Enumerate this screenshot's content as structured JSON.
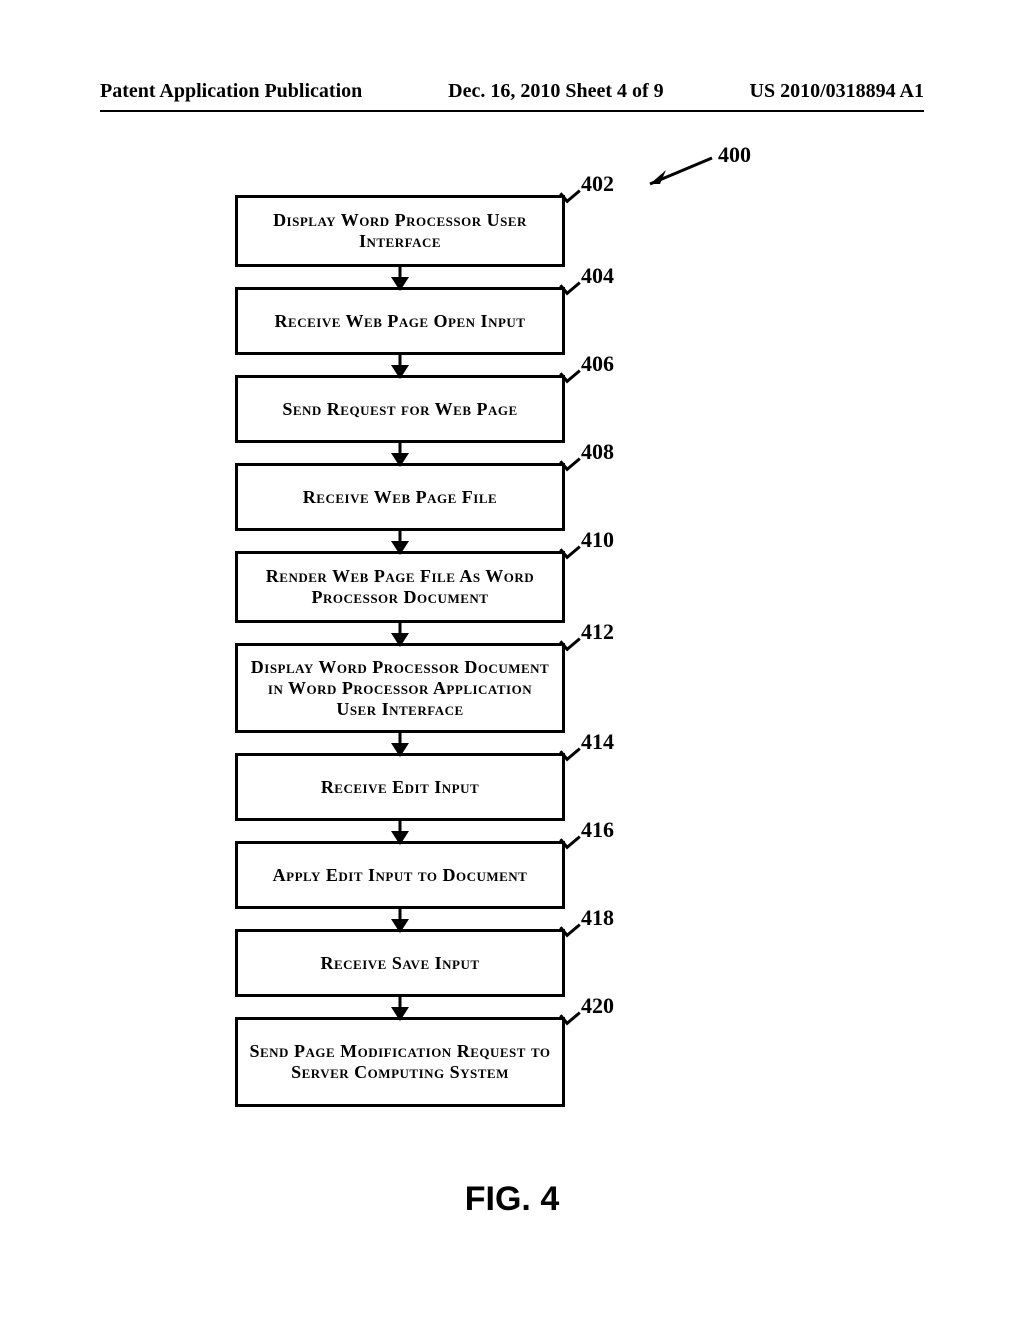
{
  "header": {
    "left": "Patent Application Publication",
    "center": "Dec. 16, 2010  Sheet 4 of 9",
    "right": "US 2010/0318894 A1"
  },
  "figure": {
    "label": "FIG. 4",
    "overall_ref": "400",
    "steps": [
      {
        "ref": "402",
        "text": "Display Word Processor User Interface"
      },
      {
        "ref": "404",
        "text": "Receive Web Page Open Input"
      },
      {
        "ref": "406",
        "text": "Send Request for Web Page"
      },
      {
        "ref": "408",
        "text": "Receive Web Page File"
      },
      {
        "ref": "410",
        "text": "Render Web Page File As Word Processor Document"
      },
      {
        "ref": "412",
        "text": "Display Word Processor Document in Word Processor Application User Interface"
      },
      {
        "ref": "414",
        "text": "Receive Edit Input"
      },
      {
        "ref": "416",
        "text": "Apply Edit Input to Document"
      },
      {
        "ref": "418",
        "text": "Receive Save Input"
      },
      {
        "ref": "420",
        "text": "Send Page Modification Request to Server Computing System"
      }
    ]
  }
}
